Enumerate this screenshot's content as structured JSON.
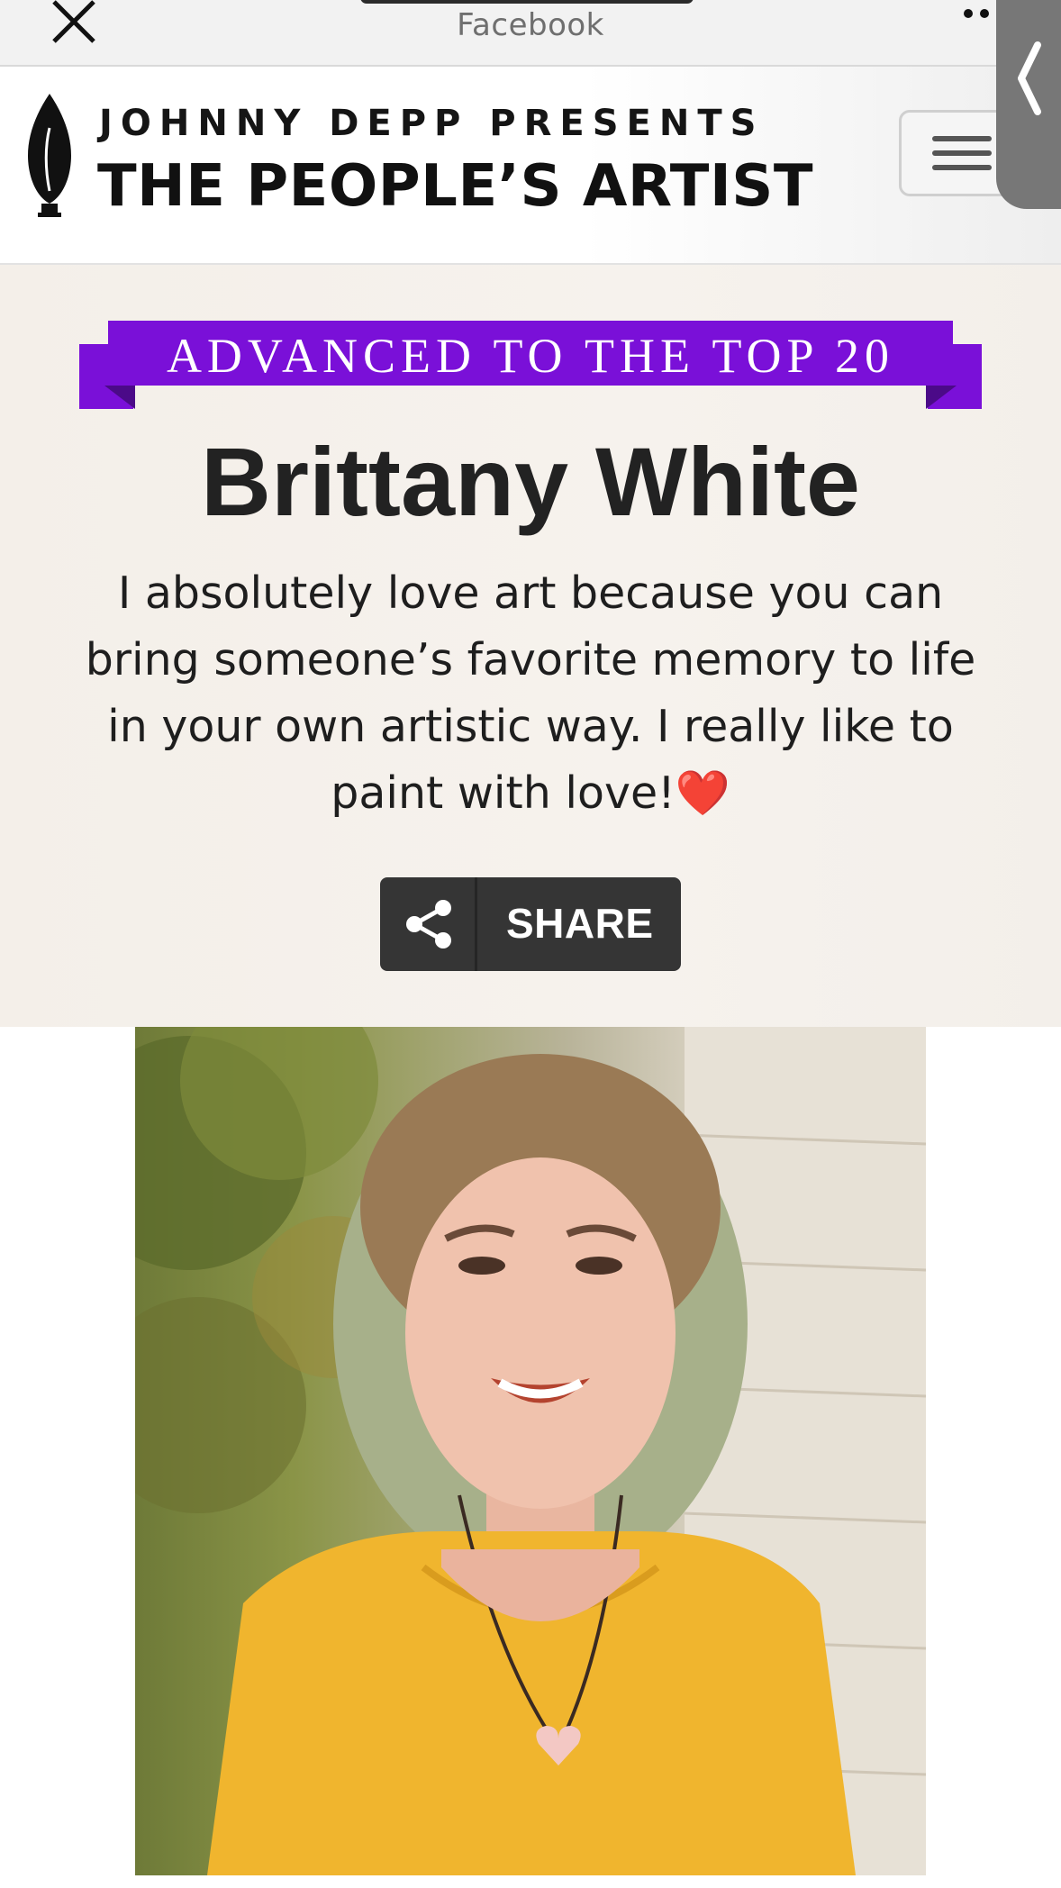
{
  "browser": {
    "source_label": "Facebook",
    "close_icon": "close-icon",
    "more_icon": "more-dots-icon"
  },
  "header": {
    "presents": "JOHNNY DEPP PRESENTS",
    "title": "THE PEOPLE’S ARTIST",
    "logo_icon": "paintbrush-icon",
    "menu_icon": "hamburger-menu-icon",
    "side_tab_icon": "chevron-left-icon"
  },
  "hero": {
    "ribbon": "ADVANCED TO THE TOP 20",
    "name": "Brittany White",
    "bio": "I absolutely love art because you can bring someone’s favorite memory to life in your own artistic way. I really like to paint with love!",
    "bio_emoji": "❤️",
    "share_label": "SHARE",
    "share_icon": "share-icon"
  },
  "photo": {
    "subject": "portrait-photo"
  },
  "colors": {
    "ribbon": "#7a10d8",
    "ribbon_fold": "#4b0a88",
    "share_button": "#353535",
    "hero_background": "#f4efe9",
    "heart": "#e3141b"
  }
}
